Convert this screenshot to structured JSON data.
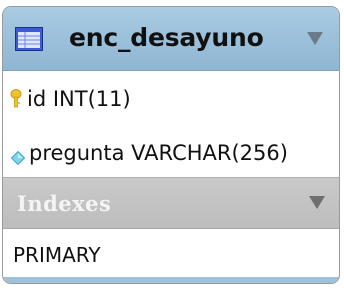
{
  "table": {
    "name": "enc_desayuno",
    "icon": "table-icon",
    "collapse_icon": "collapse-arrow-icon"
  },
  "columns": [
    {
      "label": "id INT(11)",
      "icon": "primary-key-icon"
    },
    {
      "label": "pregunta VARCHAR(256)",
      "icon": "column-diamond-icon"
    }
  ],
  "indexes": {
    "title": "Indexes",
    "items": [
      "PRIMARY"
    ]
  },
  "colors": {
    "header": "#a0c4df",
    "indexes_header": "#c4c4c4",
    "key": "#f2c22e",
    "diamond": "#7fd6ea"
  }
}
